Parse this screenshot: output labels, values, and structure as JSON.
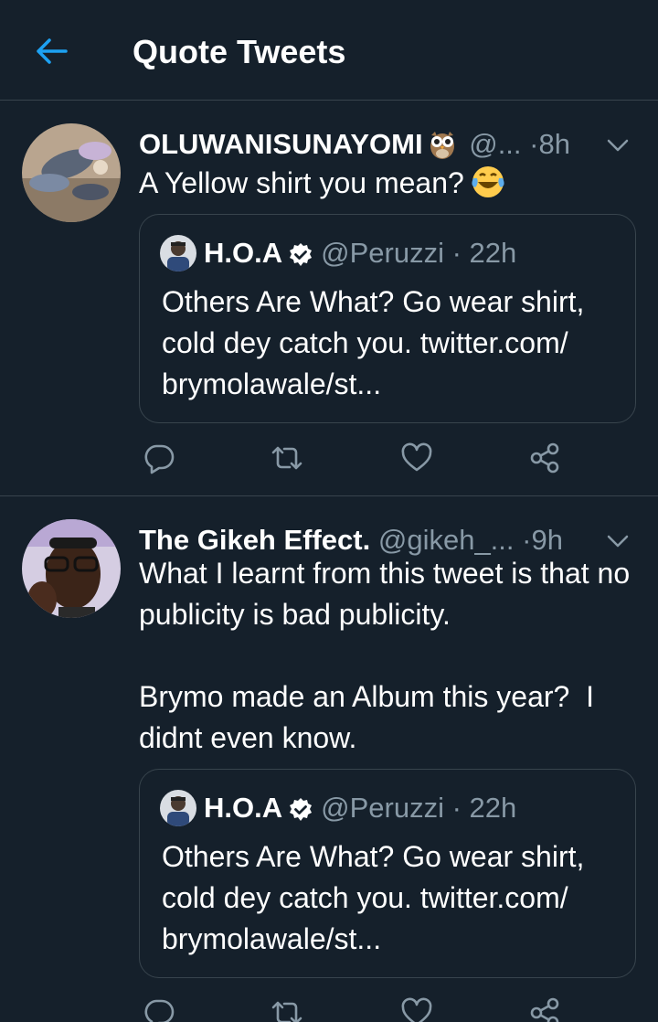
{
  "header": {
    "title": "Quote Tweets",
    "back_icon": "arrow-left-icon",
    "accent": "#1da1f2"
  },
  "tweets": [
    {
      "name": "OLUWANISUNAYOMI",
      "name_emoji": "owl-icon",
      "handle": "@...",
      "time": "8h",
      "text": "A Yellow shirt you mean?",
      "text_emoji": "laughing-tears-icon",
      "quoted": {
        "name": "H.O.A",
        "handle": "@Peruzzi",
        "time": "22h",
        "text": "Others Are What? Go wear shirt, cold dey catch you. twitter.com/ brymolawale/st..."
      }
    },
    {
      "name": "The Gikeh Effect.",
      "handle": "@gikeh_...",
      "time": "9h",
      "text": "What I learnt from this tweet is that no publicity is bad publicity.\n\nBrymo made an Album this year?  I didnt even know.",
      "quoted": {
        "name": "H.O.A",
        "handle": "@Peruzzi",
        "time": "22h",
        "text": "Others Are What? Go wear shirt, cold dey catch you. twitter.com/ brymolawale/st..."
      }
    }
  ],
  "separator": "·",
  "colors": {
    "background": "#15202b",
    "border": "#38444d",
    "secondary_text": "#8899a6",
    "primary_text": "#ffffff"
  }
}
